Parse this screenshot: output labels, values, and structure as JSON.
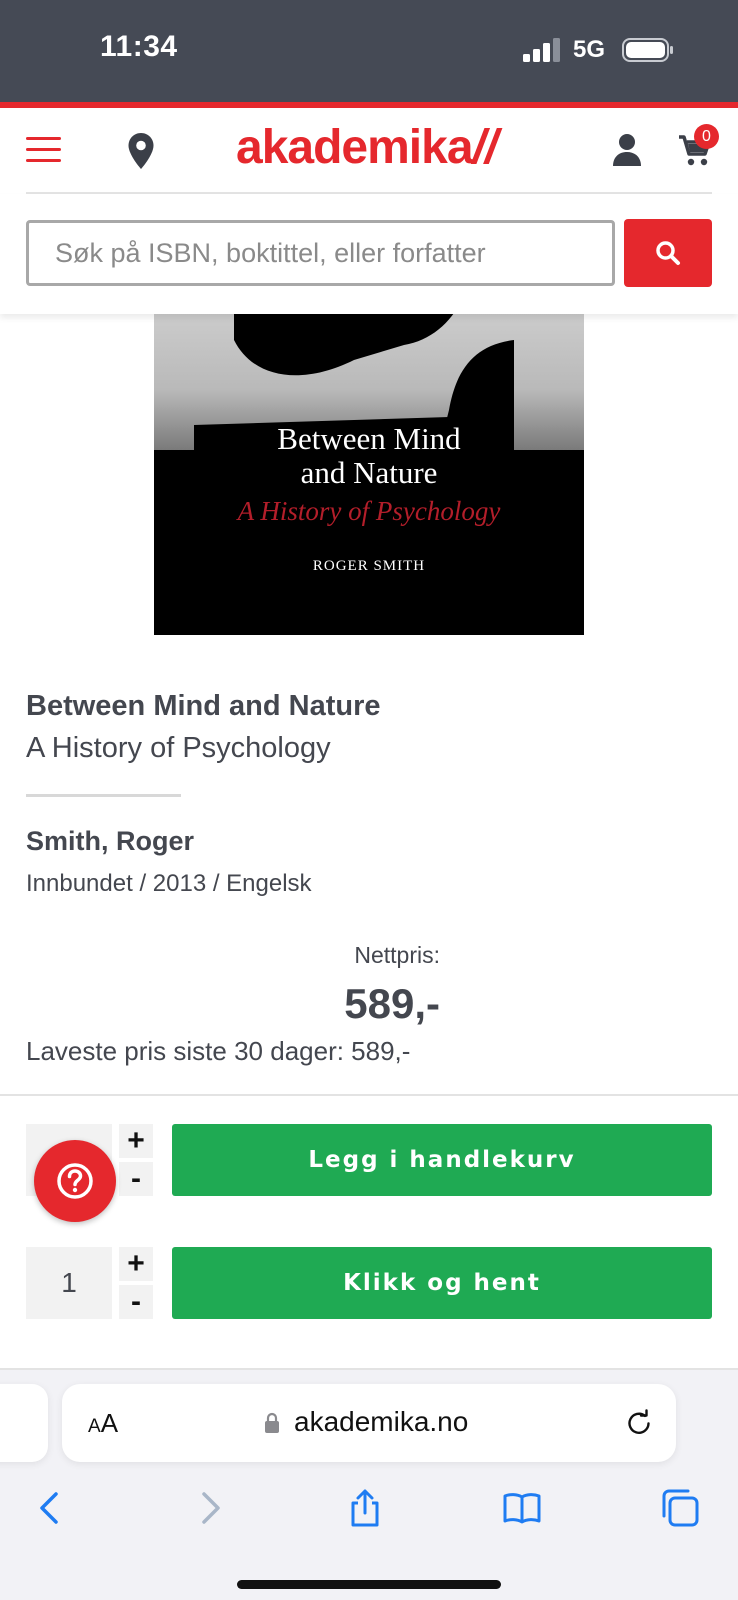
{
  "status_bar": {
    "time": "11:34",
    "network": "5G"
  },
  "header": {
    "logo_text": "akademika",
    "logo_ticks": "//",
    "cart_count": "0"
  },
  "search": {
    "placeholder": "Søk på ISBN, boktittel, eller forfatter",
    "value": ""
  },
  "cover": {
    "title_line1": "Between Mind",
    "title_line2": "and Nature",
    "subtitle": "A History of Psychology",
    "author": "ROGER SMITH"
  },
  "product": {
    "title": "Between Mind and Nature",
    "subtitle": "A History of Psychology",
    "author": "Smith, Roger",
    "meta": "Innbundet / 2013 / Engelsk",
    "price_label": "Nettpris:",
    "price": "589,-",
    "lowest_price": "Laveste pris siste 30 dager: 589,-"
  },
  "purchase": {
    "plus_label": "+",
    "minus_label": "-",
    "add_to_cart_label": "Legg i handlekurv",
    "qty_2": "1",
    "click_collect_label": "Klikk og hent"
  },
  "browser": {
    "aa_small": "A",
    "aa_large": "A",
    "url": "akademika.no"
  },
  "colors": {
    "brand_red": "#e5282d",
    "action_green": "#1faa53",
    "status_bar": "#454a55",
    "text": "#44474f",
    "ios_blue": "#1f7cf2"
  }
}
